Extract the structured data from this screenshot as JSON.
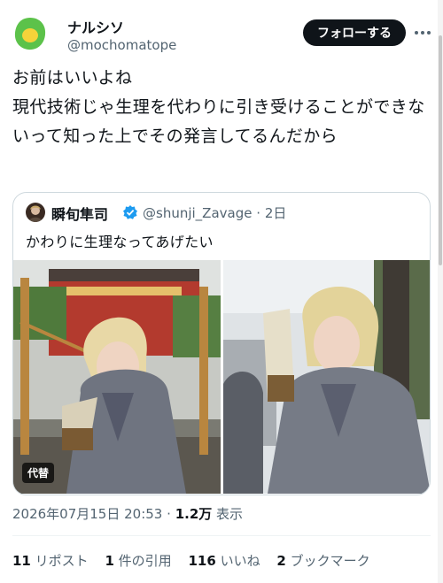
{
  "author": {
    "display_name": "ナルシソ",
    "handle": "@mochomatope",
    "follow_label": "フォローする"
  },
  "tweet": {
    "text": "お前はいいよね\n現代技術じゃ生理を代わりに引き受けることができないって知った上でその発言してるんだから"
  },
  "quoted": {
    "display_name": "瞬旬隼司",
    "handle": "@shunji_Zavage",
    "separator": "·",
    "age": "2日",
    "text": "かわりに生理なってあげたい",
    "alt_badge": "代替"
  },
  "meta": {
    "timestamp": "2026年07月15日 20:53",
    "separator": "·",
    "views_count": "1.2万",
    "views_label": "表示"
  },
  "stats": [
    {
      "num": "11",
      "label": "リポスト"
    },
    {
      "num": "1",
      "label": "件の引用"
    },
    {
      "num": "116",
      "label": "いいね"
    },
    {
      "num": "2",
      "label": "ブックマーク"
    }
  ],
  "icons": {
    "avatar": "green-blob-avatar",
    "more": "more-icon",
    "verified": "verified-badge-icon"
  },
  "colors": {
    "text": "#0f1419",
    "secondary": "#536471",
    "verified": "#1d9bf0",
    "avatar_green": "#5cc24a",
    "avatar_yellow": "#f5d33a"
  }
}
